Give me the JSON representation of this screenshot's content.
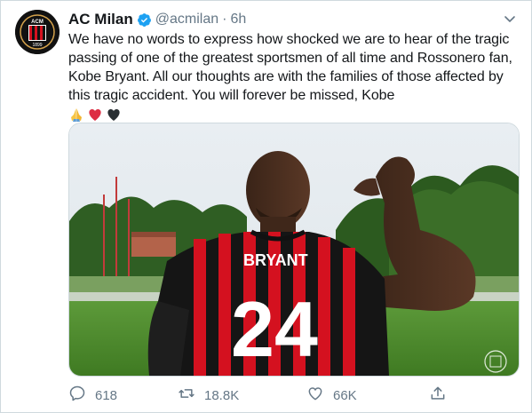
{
  "tweet": {
    "author_name": "AC Milan",
    "handle": "@acmilan",
    "separator": "·",
    "time": "6h",
    "text": "We have no words to express how shocked we are to hear of the tragic passing of one of the greatest sportsmen of all time and Rossonero fan, Kobe Bryant. All our thoughts are with the families of those affected by this tragic accident. You will forever be missed, Kobe",
    "emojis": [
      "folded-hands",
      "red-heart",
      "black-heart"
    ],
    "media": {
      "jersey_name": "BRYANT",
      "jersey_number": "24"
    },
    "stats": {
      "replies": "618",
      "retweets": "18.8K",
      "likes": "66K"
    }
  },
  "colors": {
    "text": "#14171a",
    "secondary": "#657786",
    "verified": "#1da1f2",
    "milan_red": "#d4111f"
  },
  "icons": [
    "reply-icon",
    "retweet-icon",
    "like-icon",
    "share-icon",
    "verified-icon",
    "chevron-down-icon"
  ]
}
